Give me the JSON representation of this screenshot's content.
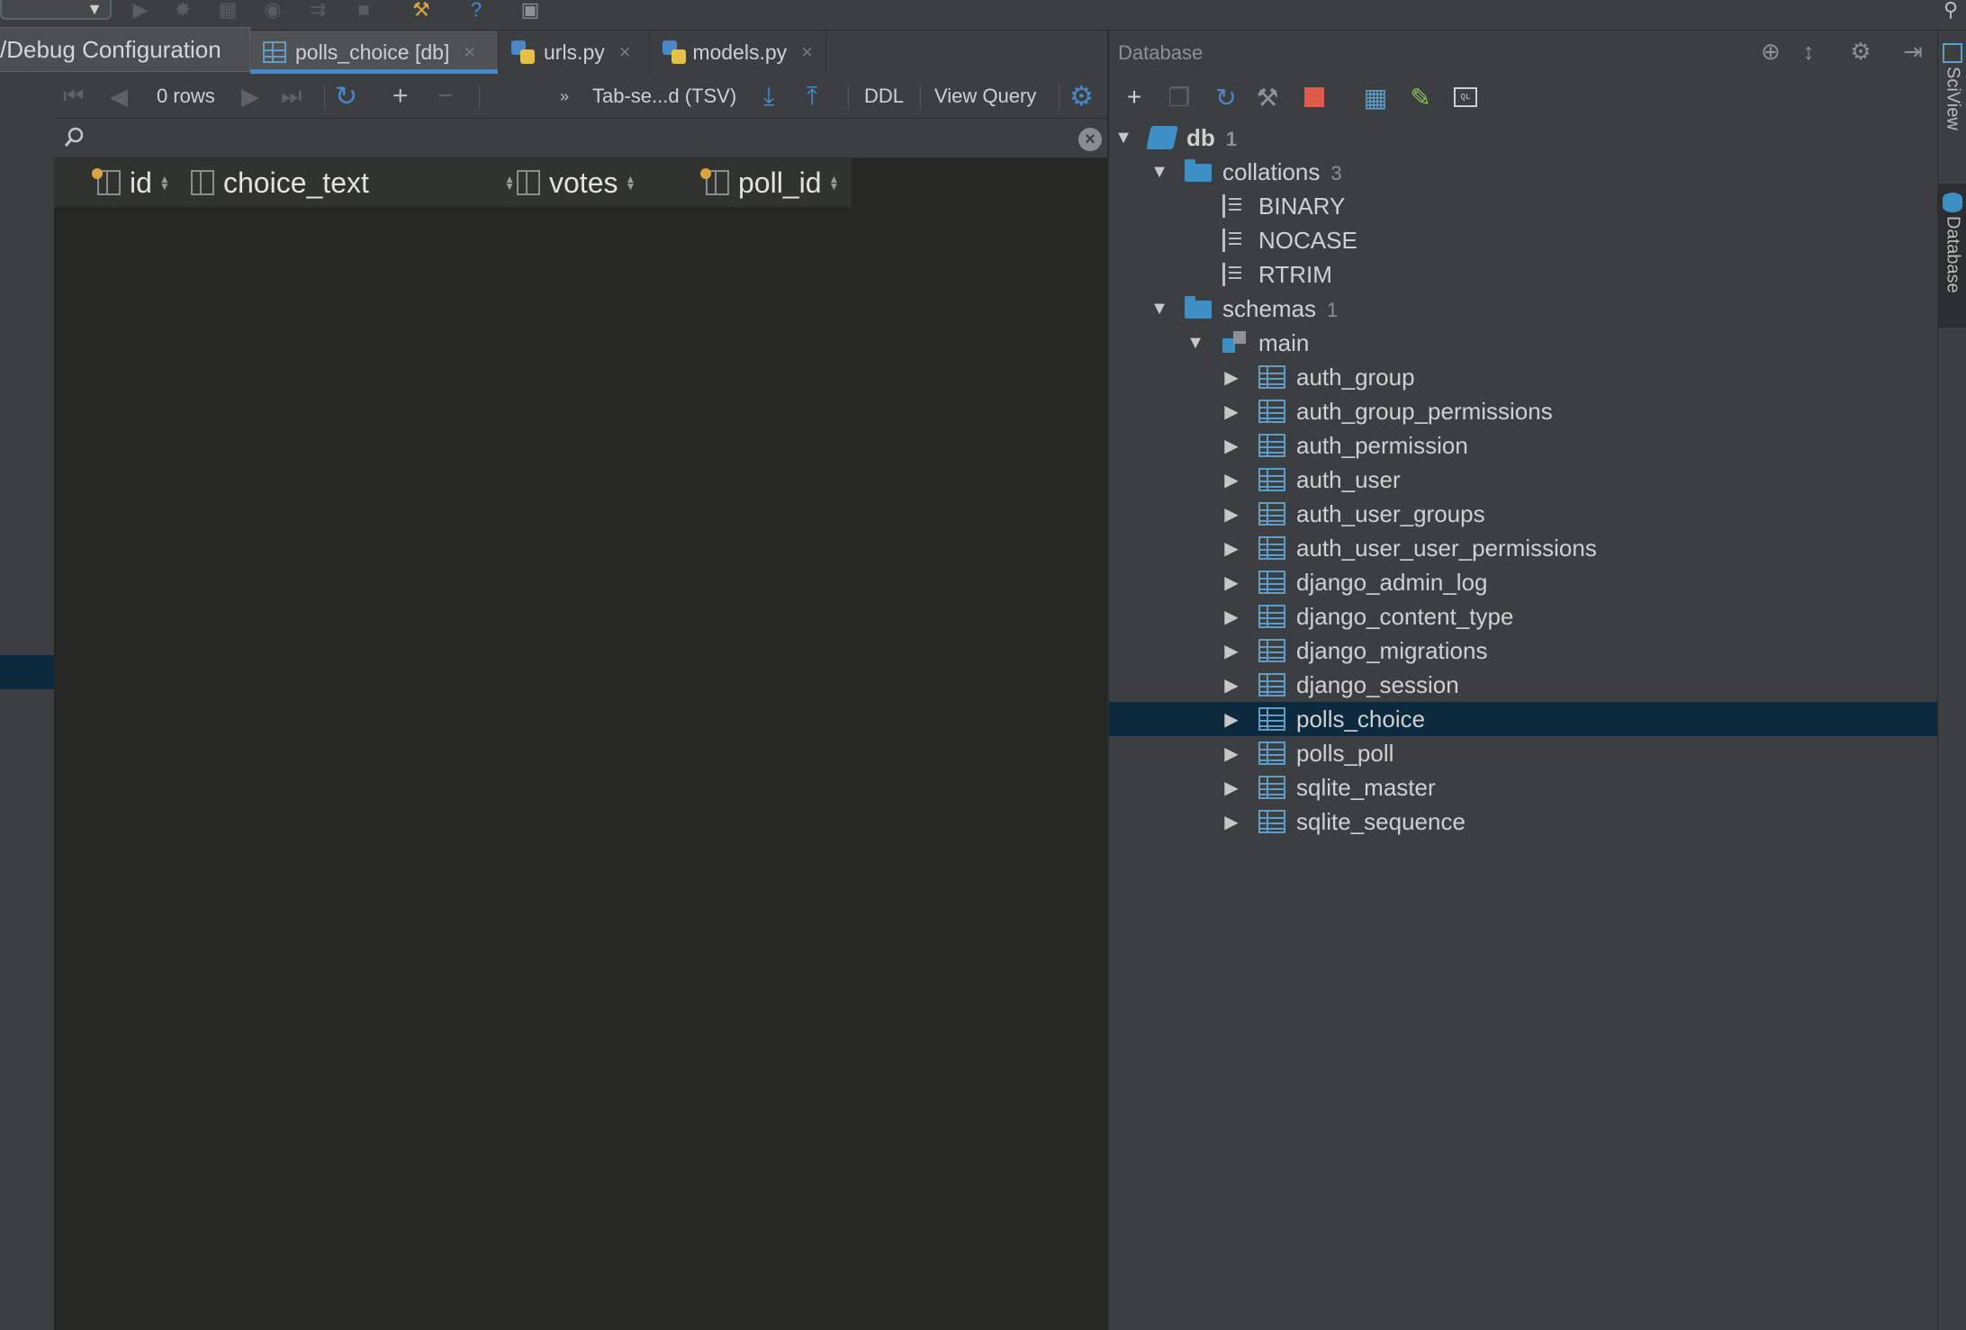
{
  "run_config": {
    "tooltip": "/Debug Configuration"
  },
  "editor_tabs": [
    {
      "label": "polls_choice [db]",
      "active": true,
      "icon": "table-icon"
    },
    {
      "label": "urls.py",
      "active": false,
      "icon": "python-file-icon"
    },
    {
      "label": "models.py",
      "active": false,
      "icon": "python-file-icon"
    }
  ],
  "data_toolbar": {
    "rows": "0 rows",
    "export_format": "Tab-se...d (TSV)",
    "ddl": "DDL",
    "view_query": "View Query"
  },
  "grid": {
    "columns": [
      {
        "name": "id",
        "key": true
      },
      {
        "name": "choice_text",
        "key": false
      },
      {
        "name": "votes",
        "key": false
      },
      {
        "name": "poll_id",
        "key": true
      }
    ],
    "rows": []
  },
  "database_panel": {
    "title": "Database",
    "tree": {
      "db": {
        "label": "db",
        "count": "1"
      },
      "collations": {
        "label": "collations",
        "count": "3",
        "items": [
          "BINARY",
          "NOCASE",
          "RTRIM"
        ]
      },
      "schemas": {
        "label": "schemas",
        "count": "1"
      },
      "main": {
        "label": "main"
      },
      "tables": [
        "auth_group",
        "auth_group_permissions",
        "auth_permission",
        "auth_user",
        "auth_user_groups",
        "auth_user_user_permissions",
        "django_admin_log",
        "django_content_type",
        "django_migrations",
        "django_session",
        "polls_choice",
        "polls_poll",
        "sqlite_master",
        "sqlite_sequence"
      ],
      "selected_table": "polls_choice"
    }
  },
  "side_tabs": {
    "sciview": "SciView",
    "database": "Database"
  },
  "colors": {
    "selection": "#0d293e",
    "accent": "#4a88c7",
    "grid_bg": "#262623"
  }
}
